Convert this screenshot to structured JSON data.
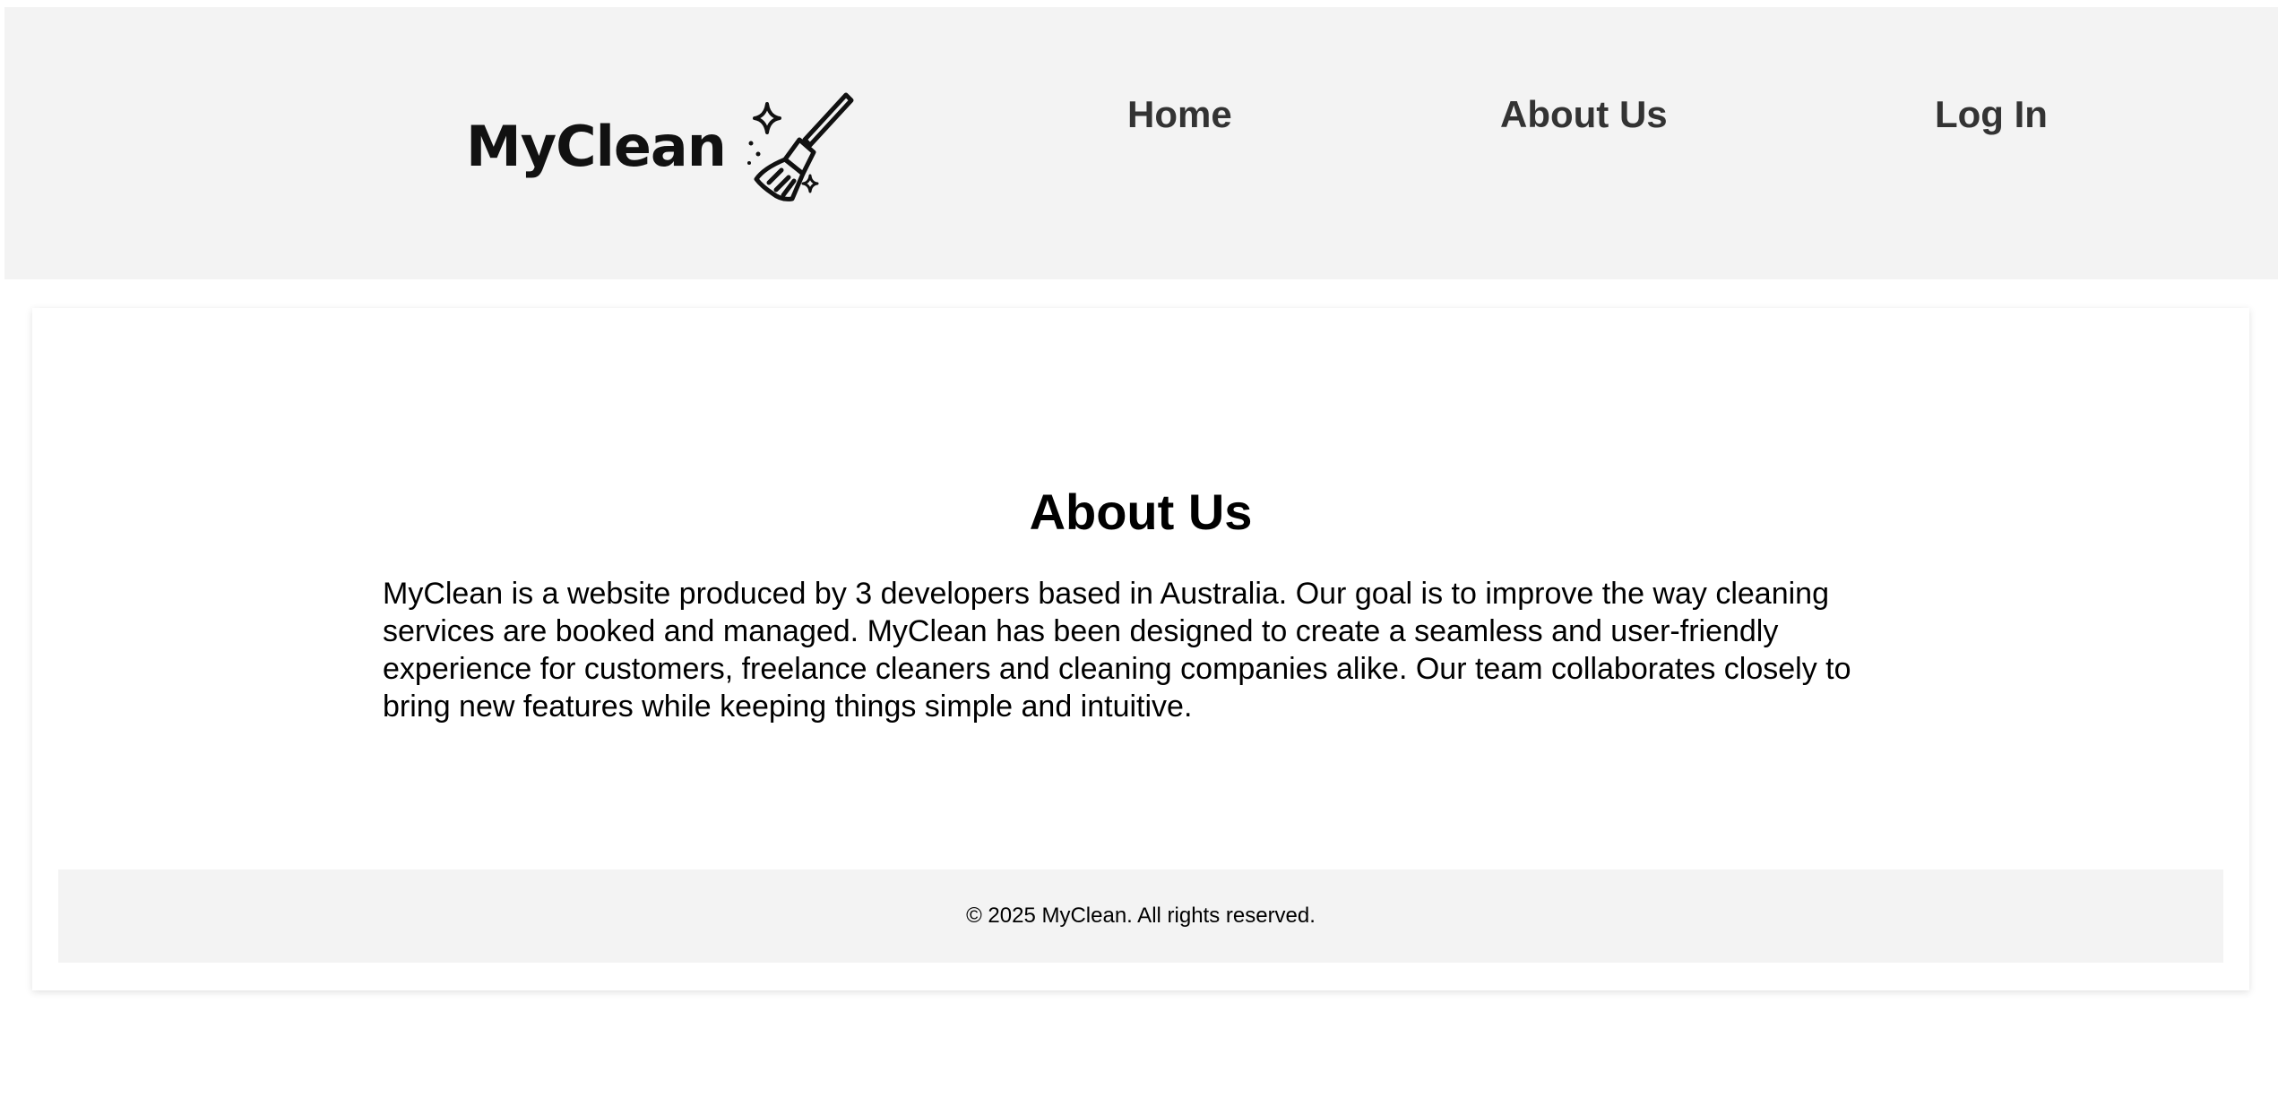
{
  "header": {
    "logo_text": "MyClean",
    "logo_icon": "broom-sparkle-icon",
    "nav": {
      "home": "Home",
      "about": "About Us",
      "login": "Log In"
    }
  },
  "main": {
    "title": "About Us",
    "body": "MyClean is a website produced by 3 developers based in Australia. Our goal is to improve the way cleaning services are booked and managed. MyClean has been designed to create a seamless and user-friendly experience for customers, freelance cleaners and cleaning companies alike. Our team collaborates closely to bring new features while keeping things simple and intuitive."
  },
  "footer": {
    "copyright": "© 2025 MyClean. All rights reserved."
  },
  "colors": {
    "header_bg": "#f3f3f3",
    "nav_text": "#333333",
    "footer_bg": "#f3f3f3"
  }
}
